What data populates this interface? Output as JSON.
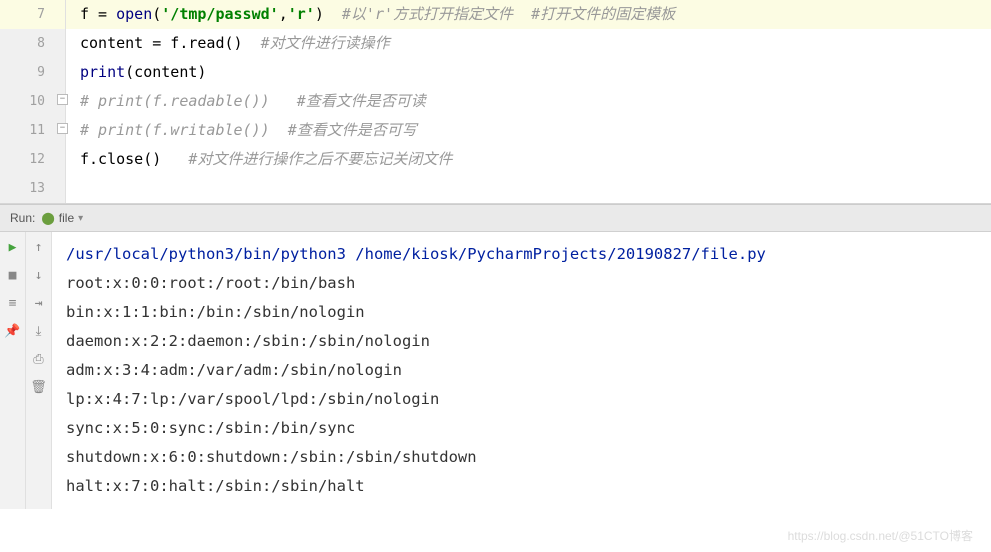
{
  "editor": {
    "lines": [
      {
        "num": 7,
        "current": true,
        "segs": [
          {
            "t": "f = ",
            "c": ""
          },
          {
            "t": "open",
            "c": "builtin"
          },
          {
            "t": "(",
            "c": ""
          },
          {
            "t": "'/tmp/passwd'",
            "c": "str"
          },
          {
            "t": ",",
            "c": ""
          },
          {
            "t": "'r'",
            "c": "str"
          },
          {
            "t": ")  ",
            "c": ""
          },
          {
            "t": "#以'r'方式打开指定文件  #打开文件的固定模板",
            "c": "comment"
          }
        ]
      },
      {
        "num": 8,
        "segs": [
          {
            "t": "content = f.read()  ",
            "c": ""
          },
          {
            "t": "#对文件进行读操作",
            "c": "comment"
          }
        ]
      },
      {
        "num": 9,
        "segs": [
          {
            "t": "print",
            "c": "builtin"
          },
          {
            "t": "(content)",
            "c": ""
          }
        ]
      },
      {
        "num": 10,
        "fold": true,
        "segs": [
          {
            "t": "# print(f.readable())   #查看文件是否可读",
            "c": "comment"
          }
        ]
      },
      {
        "num": 11,
        "fold": true,
        "segs": [
          {
            "t": "# print(f.writable())  #查看文件是否可写",
            "c": "comment"
          }
        ]
      },
      {
        "num": 12,
        "segs": [
          {
            "t": "f.close()   ",
            "c": ""
          },
          {
            "t": "#对文件进行操作之后不要忘记关闭文件",
            "c": "comment"
          }
        ]
      },
      {
        "num": 13,
        "segs": []
      }
    ]
  },
  "run": {
    "label": "Run:",
    "tab": "file",
    "command": "/usr/local/python3/bin/python3  /home/kiosk/PycharmProjects/20190827/file.py",
    "output": [
      "root:x:0:0:root:/root:/bin/bash",
      "bin:x:1:1:bin:/bin:/sbin/nologin",
      "daemon:x:2:2:daemon:/sbin:/sbin/nologin",
      "adm:x:3:4:adm:/var/adm:/sbin/nologin",
      "lp:x:4:7:lp:/var/spool/lpd:/sbin/nologin",
      "sync:x:5:0:sync:/sbin:/bin/sync",
      "shutdown:x:6:0:shutdown:/sbin:/sbin/shutdown",
      "halt:x:7:0:halt:/sbin:/sbin/halt"
    ]
  },
  "watermark": "https://blog.csdn.net/@51CTO博客"
}
